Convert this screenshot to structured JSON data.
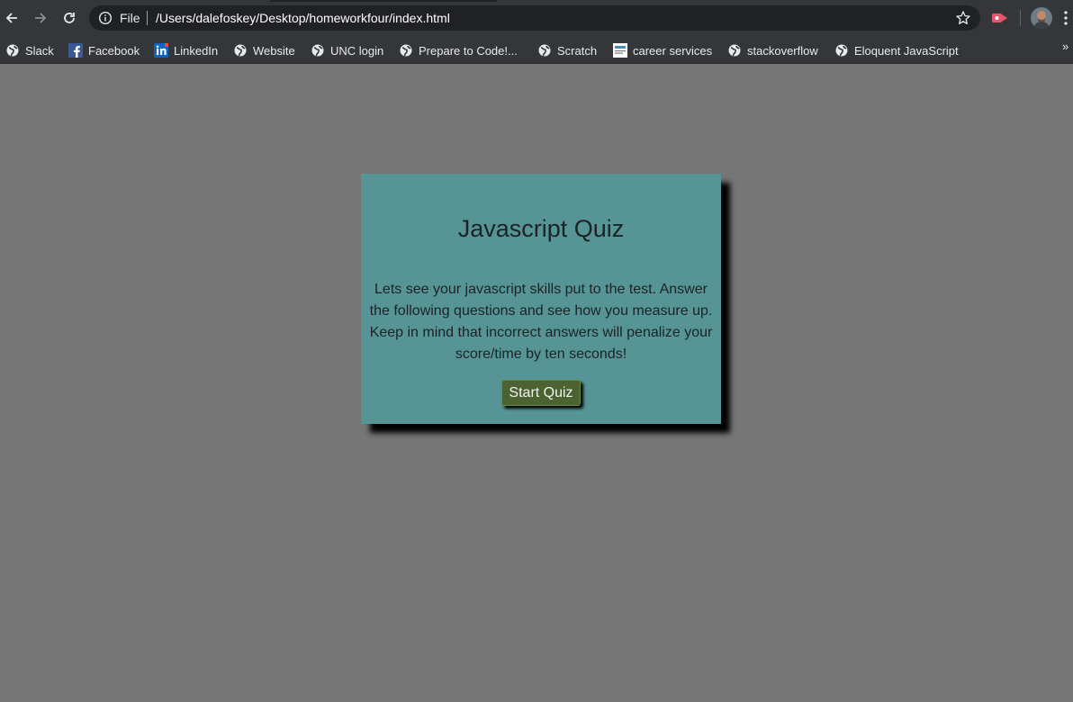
{
  "browser": {
    "address_bar": {
      "scheme_label": "File",
      "url": "/Users/dalefoskey/Desktop/homeworkfour/index.html"
    },
    "bookmarks": [
      {
        "label": "Slack",
        "icon": "globe-icon"
      },
      {
        "label": "Facebook",
        "icon": "facebook-icon"
      },
      {
        "label": "LinkedIn",
        "icon": "linkedin-icon"
      },
      {
        "label": "Website",
        "icon": "globe-icon"
      },
      {
        "label": "UNC login",
        "icon": "globe-icon"
      },
      {
        "label": "Prepare to Code!...",
        "icon": "globe-icon"
      },
      {
        "label": "Scratch",
        "icon": "globe-icon"
      },
      {
        "label": "career services",
        "icon": "career-services-icon"
      },
      {
        "label": "stackoverflow",
        "icon": "globe-icon"
      },
      {
        "label": "Eloquent JavaScript",
        "icon": "globe-icon"
      }
    ],
    "overflow_label": "»"
  },
  "quiz": {
    "title": "Javascript Quiz",
    "description": "Lets see your javascript skills put to the test. Answer the following questions and see how you measure up. Keep in mind that incorrect answers will penalize your score/time by ten seconds!",
    "start_label": "Start Quiz"
  },
  "colors": {
    "page_background": "#767676",
    "card_background": "#569496",
    "button_background": "#4c6331",
    "chrome_background": "#35363a"
  }
}
